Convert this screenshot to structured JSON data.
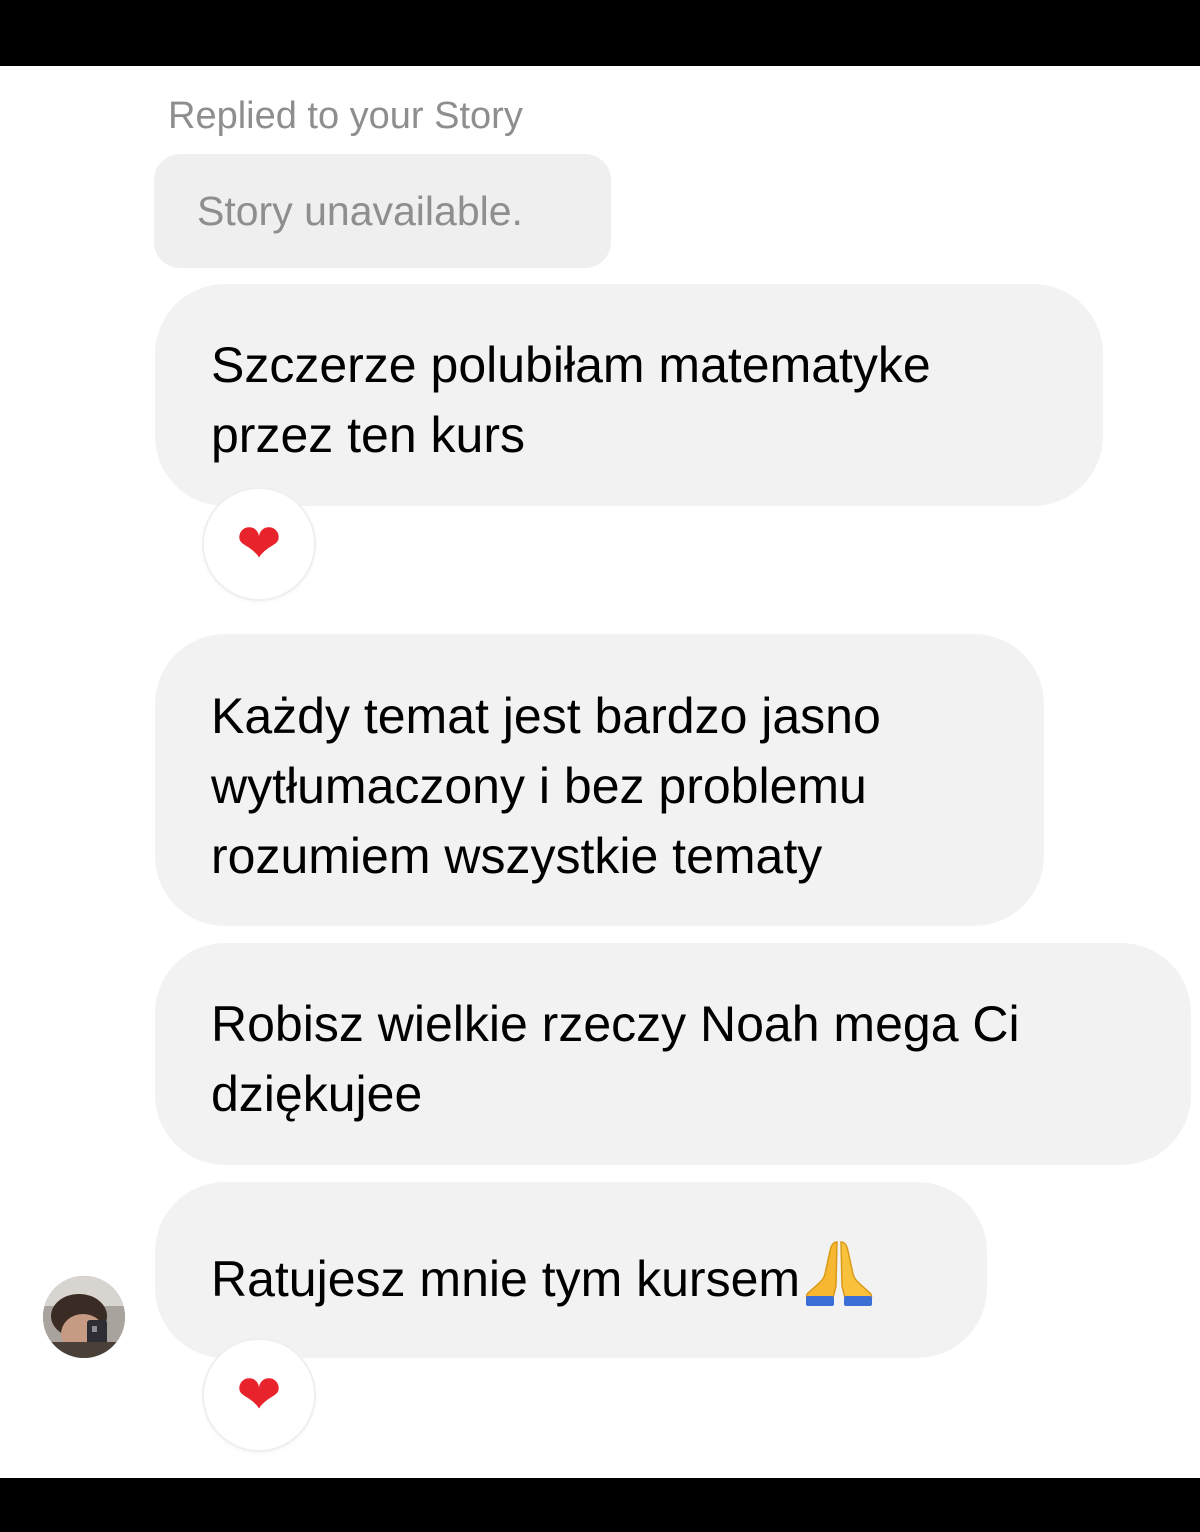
{
  "thread": {
    "reply_label": "Replied to your Story",
    "story_status": "Story unavailable.",
    "messages": [
      {
        "lines": [
          "Szczerze polubiłam matematyke",
          "przez ten kurs"
        ],
        "reaction": "heart-icon"
      },
      {
        "lines": [
          "Każdy temat jest bardzo jasno",
          "wytłumaczony i bez problemu",
          "rozumiem wszystkie tematy"
        ]
      },
      {
        "lines": [
          "Robisz wielkie rzeczy Noah mega Ci",
          "dziękujee"
        ]
      },
      {
        "lines": [
          "Ratujesz mnie tym kursem"
        ],
        "trailing_emoji": "praying-hands-icon",
        "reaction": "heart-icon"
      }
    ]
  },
  "colors": {
    "bubble": "#f2f2f2",
    "muted_text": "#8e8e8e",
    "heart": "#e8232b",
    "bars": "#000000"
  }
}
